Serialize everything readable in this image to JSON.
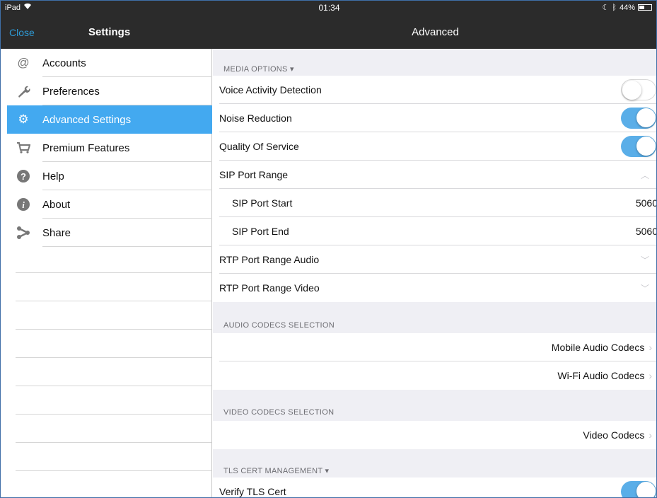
{
  "status": {
    "device": "iPad",
    "time": "01:34",
    "battery": "44%",
    "battery_level": 0.44
  },
  "nav": {
    "close": "Close",
    "settings_title": "Settings",
    "detail_title": "Advanced"
  },
  "sidebar": {
    "items": [
      {
        "label": "Accounts",
        "icon": "at-icon"
      },
      {
        "label": "Preferences",
        "icon": "wrench-icon"
      },
      {
        "label": "Advanced Settings",
        "icon": "gears-icon"
      },
      {
        "label": "Premium Features",
        "icon": "cart-icon"
      },
      {
        "label": "Help",
        "icon": "help-icon"
      },
      {
        "label": "About",
        "icon": "info-icon"
      },
      {
        "label": "Share",
        "icon": "share-icon"
      }
    ]
  },
  "main": {
    "media_header": "MEDIA OPTIONS ▾",
    "vad": "Voice Activity Detection",
    "noise": "Noise Reduction",
    "qos": "Quality Of Service",
    "sip_range": "SIP Port Range",
    "sip_start": "SIP Port Start",
    "sip_start_value": "5060",
    "sip_end": "SIP Port End",
    "sip_end_value": "5060",
    "rtp_audio": "RTP Port Range Audio",
    "rtp_video": "RTP Port Range Video",
    "audio_header": "AUDIO CODECS SELECTION",
    "mobile_audio": "Mobile Audio Codecs",
    "wifi_audio": "Wi-Fi Audio Codecs",
    "video_header": "VIDEO CODECS SELECTION",
    "video_codecs": "Video Codecs",
    "tls_header": "TLS CERT MANAGEMENT ▾",
    "verify_tls": "Verify TLS Cert"
  },
  "toggles": {
    "vad": false,
    "noise": true,
    "qos": true,
    "verify_tls": true
  }
}
